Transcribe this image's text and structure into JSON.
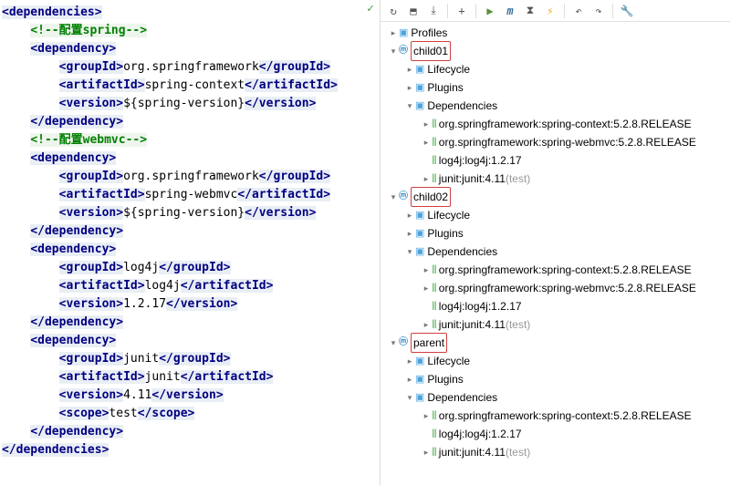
{
  "editor": {
    "checkmark": "✓",
    "lines": [
      {
        "indent": 0,
        "parts": [
          {
            "t": "<",
            "c": "tag",
            "bg": 1
          },
          {
            "t": "dependencies",
            "c": "tag",
            "bg": 1
          },
          {
            "t": ">",
            "c": "tag",
            "bg": 1
          }
        ]
      },
      {
        "indent": 1,
        "parts": [
          {
            "t": "<!--配置spring-->",
            "c": "attr-val",
            "bg": 2
          }
        ]
      },
      {
        "indent": 1,
        "parts": [
          {
            "t": "<",
            "c": "tag",
            "bg": 1
          },
          {
            "t": "dependency",
            "c": "tag",
            "bg": 1
          },
          {
            "t": ">",
            "c": "tag",
            "bg": 1
          }
        ]
      },
      {
        "indent": 2,
        "parts": [
          {
            "t": "<",
            "c": "tag",
            "bg": 1
          },
          {
            "t": "groupId",
            "c": "tag",
            "bg": 1
          },
          {
            "t": ">",
            "c": "tag",
            "bg": 1
          },
          {
            "t": "org.springframework",
            "c": "text-val"
          },
          {
            "t": "</",
            "c": "tag",
            "bg": 1
          },
          {
            "t": "groupId",
            "c": "tag",
            "bg": 1
          },
          {
            "t": ">",
            "c": "tag",
            "bg": 1
          }
        ]
      },
      {
        "indent": 2,
        "parts": [
          {
            "t": "<",
            "c": "tag",
            "bg": 1
          },
          {
            "t": "artifactId",
            "c": "tag",
            "bg": 1
          },
          {
            "t": ">",
            "c": "tag",
            "bg": 1
          },
          {
            "t": "spring-context",
            "c": "text-val"
          },
          {
            "t": "</",
            "c": "tag",
            "bg": 1
          },
          {
            "t": "artifactId",
            "c": "tag",
            "bg": 1
          },
          {
            "t": ">",
            "c": "tag",
            "bg": 1
          }
        ]
      },
      {
        "indent": 2,
        "parts": [
          {
            "t": "<",
            "c": "tag",
            "bg": 1
          },
          {
            "t": "version",
            "c": "tag",
            "bg": 1
          },
          {
            "t": ">",
            "c": "tag",
            "bg": 1
          },
          {
            "t": "${spring-version}",
            "c": "text-val"
          },
          {
            "t": "</",
            "c": "tag",
            "bg": 1
          },
          {
            "t": "version",
            "c": "tag",
            "bg": 1
          },
          {
            "t": ">",
            "c": "tag",
            "bg": 1
          }
        ]
      },
      {
        "indent": 1,
        "parts": [
          {
            "t": "</",
            "c": "tag",
            "bg": 1
          },
          {
            "t": "dependency",
            "c": "tag",
            "bg": 1
          },
          {
            "t": ">",
            "c": "tag",
            "bg": 1
          }
        ]
      },
      {
        "indent": 1,
        "parts": [
          {
            "t": "<!--配置webmvc-->",
            "c": "attr-val",
            "bg": 2
          }
        ]
      },
      {
        "indent": 1,
        "parts": [
          {
            "t": "<",
            "c": "tag",
            "bg": 1
          },
          {
            "t": "dependency",
            "c": "tag",
            "bg": 1
          },
          {
            "t": ">",
            "c": "tag",
            "bg": 1
          }
        ]
      },
      {
        "indent": 2,
        "parts": [
          {
            "t": "<",
            "c": "tag",
            "bg": 1
          },
          {
            "t": "groupId",
            "c": "tag",
            "bg": 1
          },
          {
            "t": ">",
            "c": "tag",
            "bg": 1
          },
          {
            "t": "org.springframework",
            "c": "text-val"
          },
          {
            "t": "</",
            "c": "tag",
            "bg": 1
          },
          {
            "t": "groupId",
            "c": "tag",
            "bg": 1
          },
          {
            "t": ">",
            "c": "tag",
            "bg": 1
          }
        ]
      },
      {
        "indent": 2,
        "parts": [
          {
            "t": "<",
            "c": "tag",
            "bg": 1
          },
          {
            "t": "artifactId",
            "c": "tag",
            "bg": 1
          },
          {
            "t": ">",
            "c": "tag",
            "bg": 1
          },
          {
            "t": "spring-webmvc",
            "c": "text-val"
          },
          {
            "t": "</",
            "c": "tag",
            "bg": 1
          },
          {
            "t": "artifactId",
            "c": "tag",
            "bg": 1
          },
          {
            "t": ">",
            "c": "tag",
            "bg": 1
          }
        ]
      },
      {
        "indent": 2,
        "parts": [
          {
            "t": "<",
            "c": "tag",
            "bg": 1
          },
          {
            "t": "version",
            "c": "tag",
            "bg": 1
          },
          {
            "t": ">",
            "c": "tag",
            "bg": 1
          },
          {
            "t": "${spring-version}",
            "c": "text-val"
          },
          {
            "t": "</",
            "c": "tag",
            "bg": 1
          },
          {
            "t": "version",
            "c": "tag",
            "bg": 1
          },
          {
            "t": ">",
            "c": "tag",
            "bg": 1
          }
        ]
      },
      {
        "indent": 1,
        "parts": [
          {
            "t": "</",
            "c": "tag",
            "bg": 1
          },
          {
            "t": "dependency",
            "c": "tag",
            "bg": 1
          },
          {
            "t": ">",
            "c": "tag",
            "bg": 1
          }
        ]
      },
      {
        "indent": 1,
        "parts": [
          {
            "t": "<",
            "c": "tag",
            "bg": 1
          },
          {
            "t": "dependency",
            "c": "tag",
            "bg": 1
          },
          {
            "t": ">",
            "c": "tag",
            "bg": 1
          }
        ]
      },
      {
        "indent": 2,
        "parts": [
          {
            "t": "<",
            "c": "tag",
            "bg": 1
          },
          {
            "t": "groupId",
            "c": "tag",
            "bg": 1
          },
          {
            "t": ">",
            "c": "tag",
            "bg": 1
          },
          {
            "t": "log4j",
            "c": "text-val"
          },
          {
            "t": "</",
            "c": "tag",
            "bg": 1
          },
          {
            "t": "groupId",
            "c": "tag",
            "bg": 1
          },
          {
            "t": ">",
            "c": "tag",
            "bg": 1
          }
        ]
      },
      {
        "indent": 2,
        "parts": [
          {
            "t": "<",
            "c": "tag",
            "bg": 1
          },
          {
            "t": "artifactId",
            "c": "tag",
            "bg": 1
          },
          {
            "t": ">",
            "c": "tag",
            "bg": 1
          },
          {
            "t": "log4j",
            "c": "text-val"
          },
          {
            "t": "</",
            "c": "tag",
            "bg": 1
          },
          {
            "t": "artifactId",
            "c": "tag",
            "bg": 1
          },
          {
            "t": ">",
            "c": "tag",
            "bg": 1
          }
        ]
      },
      {
        "indent": 2,
        "parts": [
          {
            "t": "<",
            "c": "tag",
            "bg": 1
          },
          {
            "t": "version",
            "c": "tag",
            "bg": 1
          },
          {
            "t": ">",
            "c": "tag",
            "bg": 1
          },
          {
            "t": "1.2.17",
            "c": "text-val"
          },
          {
            "t": "</",
            "c": "tag",
            "bg": 1
          },
          {
            "t": "version",
            "c": "tag",
            "bg": 1
          },
          {
            "t": ">",
            "c": "tag",
            "bg": 1
          }
        ]
      },
      {
        "indent": 1,
        "parts": [
          {
            "t": "</",
            "c": "tag",
            "bg": 1
          },
          {
            "t": "dependency",
            "c": "tag",
            "bg": 1
          },
          {
            "t": ">",
            "c": "tag",
            "bg": 1
          }
        ]
      },
      {
        "indent": 1,
        "parts": [
          {
            "t": "<",
            "c": "tag",
            "bg": 1
          },
          {
            "t": "dependency",
            "c": "tag",
            "bg": 1
          },
          {
            "t": ">",
            "c": "tag",
            "bg": 1
          }
        ]
      },
      {
        "indent": 2,
        "parts": [
          {
            "t": "<",
            "c": "tag",
            "bg": 1
          },
          {
            "t": "groupId",
            "c": "tag",
            "bg": 1
          },
          {
            "t": ">",
            "c": "tag",
            "bg": 1
          },
          {
            "t": "junit",
            "c": "text-val"
          },
          {
            "t": "</",
            "c": "tag",
            "bg": 1
          },
          {
            "t": "groupId",
            "c": "tag",
            "bg": 1
          },
          {
            "t": ">",
            "c": "tag",
            "bg": 1
          }
        ]
      },
      {
        "indent": 2,
        "parts": [
          {
            "t": "<",
            "c": "tag",
            "bg": 1
          },
          {
            "t": "artifactId",
            "c": "tag",
            "bg": 1
          },
          {
            "t": ">",
            "c": "tag",
            "bg": 1
          },
          {
            "t": "junit",
            "c": "text-val"
          },
          {
            "t": "</",
            "c": "tag",
            "bg": 1
          },
          {
            "t": "artifactId",
            "c": "tag",
            "bg": 1
          },
          {
            "t": ">",
            "c": "tag",
            "bg": 1
          }
        ]
      },
      {
        "indent": 2,
        "parts": [
          {
            "t": "<",
            "c": "tag",
            "bg": 1
          },
          {
            "t": "version",
            "c": "tag",
            "bg": 1
          },
          {
            "t": ">",
            "c": "tag",
            "bg": 1
          },
          {
            "t": "4.11",
            "c": "text-val"
          },
          {
            "t": "</",
            "c": "tag",
            "bg": 1
          },
          {
            "t": "version",
            "c": "tag",
            "bg": 1
          },
          {
            "t": ">",
            "c": "tag",
            "bg": 1
          }
        ]
      },
      {
        "indent": 2,
        "parts": [
          {
            "t": "<",
            "c": "tag",
            "bg": 1
          },
          {
            "t": "scope",
            "c": "tag",
            "bg": 1
          },
          {
            "t": ">",
            "c": "tag",
            "bg": 1
          },
          {
            "t": "test",
            "c": "text-val"
          },
          {
            "t": "</",
            "c": "tag",
            "bg": 1
          },
          {
            "t": "scope",
            "c": "tag",
            "bg": 1
          },
          {
            "t": ">",
            "c": "tag",
            "bg": 1
          }
        ]
      },
      {
        "indent": 1,
        "parts": [
          {
            "t": "</",
            "c": "tag",
            "bg": 1
          },
          {
            "t": "dependency",
            "c": "tag",
            "bg": 1
          },
          {
            "t": ">",
            "c": "tag",
            "bg": 1
          }
        ]
      },
      {
        "indent": 0,
        "parts": [
          {
            "t": "</",
            "c": "tag",
            "bg": 1
          },
          {
            "t": "dependencies",
            "c": "tag",
            "bg": 1
          },
          {
            "t": ">",
            "c": "tag",
            "bg": 1
          }
        ]
      }
    ]
  },
  "toolbar": {
    "refresh": "↻",
    "generate": "⬒",
    "download": "⤓",
    "add": "+",
    "run": "▶",
    "m": "m",
    "skip": "⧗",
    "lightning": "⚡",
    "back": "↶",
    "fwd": "↷",
    "wrench": "🔧"
  },
  "tree": [
    {
      "level": 0,
      "arrow": "right",
      "icon": "folder",
      "label": "Profiles"
    },
    {
      "level": 0,
      "arrow": "down",
      "icon": "m",
      "label": "child01",
      "hl": true
    },
    {
      "level": 1,
      "arrow": "right",
      "icon": "folder",
      "label": "Lifecycle"
    },
    {
      "level": 1,
      "arrow": "right",
      "icon": "folder",
      "label": "Plugins"
    },
    {
      "level": 1,
      "arrow": "down",
      "icon": "folder",
      "label": "Dependencies"
    },
    {
      "level": 2,
      "arrow": "right",
      "icon": "bars",
      "label": "org.springframework:spring-context:5.2.8.RELEASE"
    },
    {
      "level": 2,
      "arrow": "right",
      "icon": "bars",
      "label": "org.springframework:spring-webmvc:5.2.8.RELEASE"
    },
    {
      "level": 2,
      "arrow": "",
      "icon": "bars",
      "label": "log4j:log4j:1.2.17"
    },
    {
      "level": 2,
      "arrow": "right",
      "icon": "bars",
      "label": "junit:junit:4.11",
      "gray": " (test)"
    },
    {
      "level": 0,
      "arrow": "down",
      "icon": "m",
      "label": "child02",
      "hl": true
    },
    {
      "level": 1,
      "arrow": "right",
      "icon": "folder",
      "label": "Lifecycle"
    },
    {
      "level": 1,
      "arrow": "right",
      "icon": "folder",
      "label": "Plugins"
    },
    {
      "level": 1,
      "arrow": "down",
      "icon": "folder",
      "label": "Dependencies"
    },
    {
      "level": 2,
      "arrow": "right",
      "icon": "bars",
      "label": "org.springframework:spring-context:5.2.8.RELEASE"
    },
    {
      "level": 2,
      "arrow": "right",
      "icon": "bars",
      "label": "org.springframework:spring-webmvc:5.2.8.RELEASE"
    },
    {
      "level": 2,
      "arrow": "",
      "icon": "bars",
      "label": "log4j:log4j:1.2.17"
    },
    {
      "level": 2,
      "arrow": "right",
      "icon": "bars",
      "label": "junit:junit:4.11",
      "gray": " (test)"
    },
    {
      "level": 0,
      "arrow": "down",
      "icon": "m",
      "label": "parent",
      "hl": true
    },
    {
      "level": 1,
      "arrow": "right",
      "icon": "folder",
      "label": "Lifecycle"
    },
    {
      "level": 1,
      "arrow": "right",
      "icon": "folder",
      "label": "Plugins"
    },
    {
      "level": 1,
      "arrow": "down",
      "icon": "folder",
      "label": "Dependencies"
    },
    {
      "level": 2,
      "arrow": "right",
      "icon": "bars",
      "label": "org.springframework:spring-context:5.2.8.RELEASE"
    },
    {
      "level": 2,
      "arrow": "",
      "icon": "bars",
      "label": "log4j:log4j:1.2.17"
    },
    {
      "level": 2,
      "arrow": "right",
      "icon": "bars",
      "label": "junit:junit:4.11",
      "gray": " (test)"
    }
  ]
}
